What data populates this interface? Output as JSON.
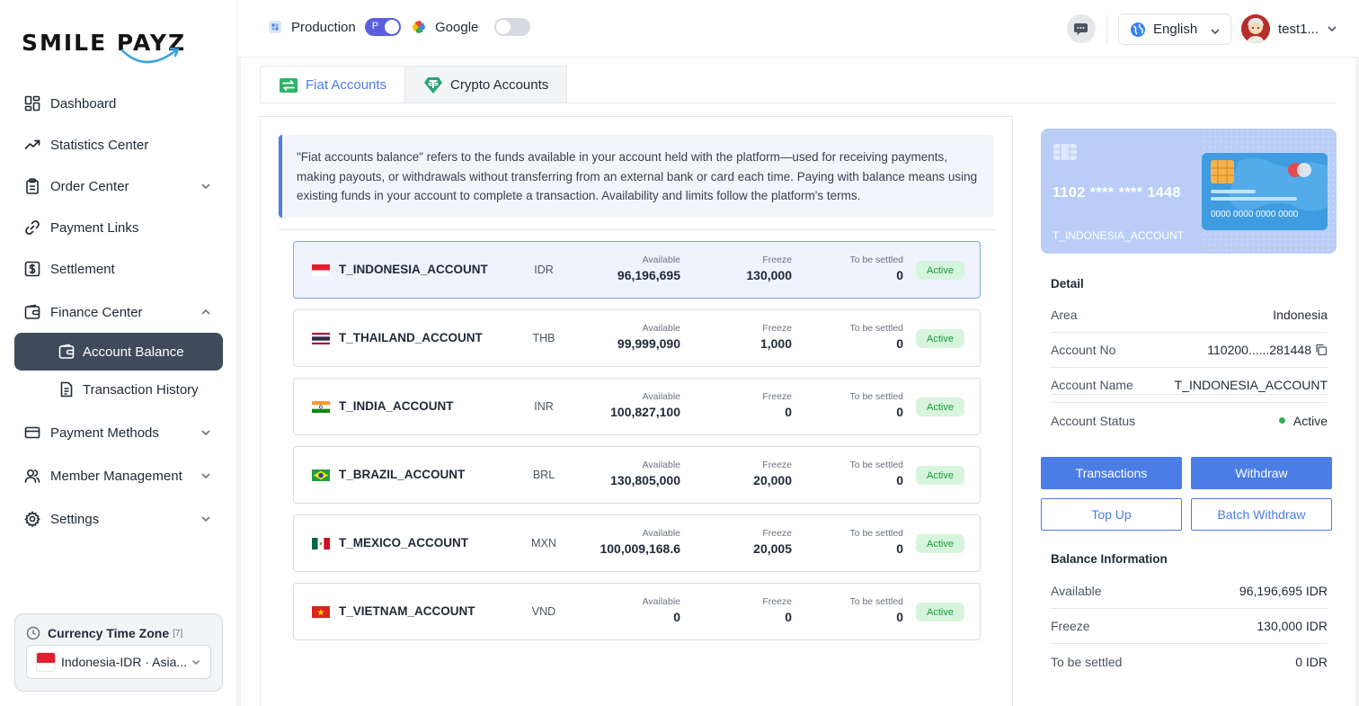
{
  "brand": {
    "name_part1": "SMILE",
    "name_part2": "PAYZ"
  },
  "sidebar": {
    "items": [
      {
        "label": "Dashboard"
      },
      {
        "label": "Statistics Center"
      },
      {
        "label": "Order Center"
      },
      {
        "label": "Payment Links"
      },
      {
        "label": "Settlement"
      },
      {
        "label": "Finance Center"
      },
      {
        "label": "Account Balance"
      },
      {
        "label": "Transaction History"
      },
      {
        "label": "Payment Methods"
      },
      {
        "label": "Member Management"
      },
      {
        "label": "Settings"
      }
    ],
    "timezone": {
      "title": "Currency Time Zone",
      "count": "[7]",
      "selected": "Indonesia-IDR · Asia..."
    }
  },
  "header": {
    "environment": "Production",
    "env_toggle_label": "P",
    "google_label": "Google",
    "language": "English",
    "username": "test1..."
  },
  "tabs": [
    {
      "label": "Fiat Accounts"
    },
    {
      "label": "Crypto Accounts"
    }
  ],
  "notice": "\"Fiat accounts balance\" refers to the funds available in your account held with the platform—used for receiving payments, making payouts, or withdrawals without transferring from an external bank or card each time. Paying with balance means using existing funds in your account to complete a transaction. Availability and limits follow the platform's terms.",
  "column_labels": {
    "available": "Available",
    "freeze": "Freeze",
    "to_be_settled": "To be settled"
  },
  "accounts": [
    {
      "name": "T_INDONESIA_ACCOUNT",
      "currency": "IDR",
      "available": "96,196,695",
      "freeze": "130,000",
      "to_be_settled": "0",
      "status": "Active"
    },
    {
      "name": "T_THAILAND_ACCOUNT",
      "currency": "THB",
      "available": "99,999,090",
      "freeze": "1,000",
      "to_be_settled": "0",
      "status": "Active"
    },
    {
      "name": "T_INDIA_ACCOUNT",
      "currency": "INR",
      "available": "100,827,100",
      "freeze": "0",
      "to_be_settled": "0",
      "status": "Active"
    },
    {
      "name": "T_BRAZIL_ACCOUNT",
      "currency": "BRL",
      "available": "130,805,000",
      "freeze": "20,000",
      "to_be_settled": "0",
      "status": "Active"
    },
    {
      "name": "T_MEXICO_ACCOUNT",
      "currency": "MXN",
      "available": "100,009,168.6",
      "freeze": "20,005",
      "to_be_settled": "0",
      "status": "Active"
    },
    {
      "name": "T_VIETNAM_ACCOUNT",
      "currency": "VND",
      "available": "0",
      "freeze": "0",
      "to_be_settled": "0",
      "status": "Active"
    }
  ],
  "card": {
    "number": "1102 **** **** 1448",
    "account_name": "T_INDONESIA_ACCOUNT",
    "mini_number": "0000 0000 0000 0000"
  },
  "detail": {
    "title": "Detail",
    "rows": [
      {
        "key": "Area",
        "value": "Indonesia"
      },
      {
        "key": "Account No",
        "value": "110200......281448"
      },
      {
        "key": "Account Name",
        "value": "T_INDONESIA_ACCOUNT"
      },
      {
        "key": "Account Status",
        "value": "Active"
      }
    ]
  },
  "actions": {
    "transactions": "Transactions",
    "withdraw": "Withdraw",
    "top_up": "Top Up",
    "batch_withdraw": "Batch Withdraw"
  },
  "balance": {
    "title": "Balance Information",
    "rows": [
      {
        "key": "Available",
        "value": "96,196,695 IDR"
      },
      {
        "key": "Freeze",
        "value": "130,000 IDR"
      },
      {
        "key": "To be settled",
        "value": "0 IDR"
      }
    ]
  },
  "colors": {
    "accent": "#4a7de6",
    "sidebar_active": "#3f4b5b",
    "toggle_on": "#5a5fe0",
    "status_green": "#2fb34d"
  }
}
